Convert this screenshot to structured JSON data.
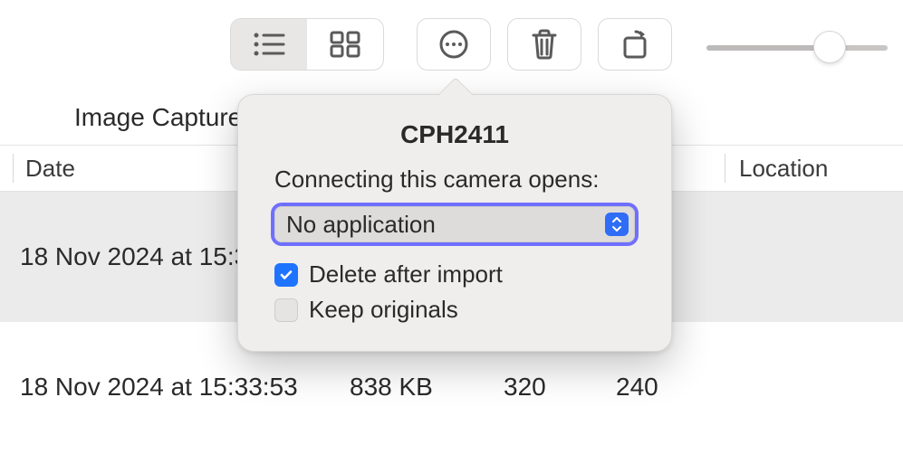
{
  "app_title": "Image Capture",
  "columns": {
    "date": "Date",
    "location": "Location"
  },
  "rows": [
    {
      "date": "18 Nov 2024 at 15:3",
      "size": "",
      "width": "",
      "height": ""
    },
    {
      "date": "18 Nov 2024 at 15:33:53",
      "size": "838 KB",
      "width": "320",
      "height": "240"
    }
  ],
  "slider": {
    "value": 0.65
  },
  "popover": {
    "title": "CPH2411",
    "connecting_label": "Connecting this camera opens:",
    "app_select_value": "No application",
    "delete_label": "Delete after import",
    "delete_checked": true,
    "keep_label": "Keep originals",
    "keep_checked": false
  },
  "icons": {
    "list": "list-icon",
    "grid": "grid-icon",
    "more": "more-icon",
    "trash": "trash-icon",
    "rotate": "rotate-icon"
  }
}
